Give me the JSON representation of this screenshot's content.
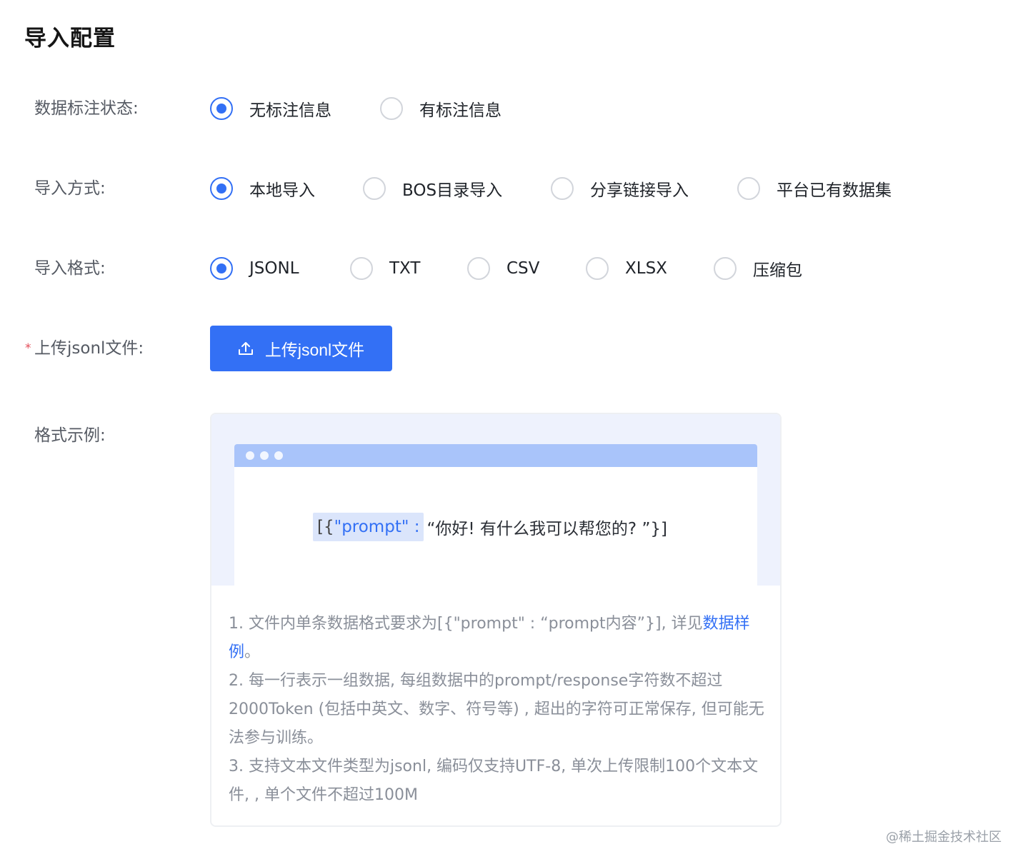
{
  "page": {
    "title": "导入配置"
  },
  "annotation_status": {
    "label": "数据标注状态:",
    "options": [
      {
        "label": "无标注信息",
        "checked": true
      },
      {
        "label": "有标注信息",
        "checked": false
      }
    ]
  },
  "import_method": {
    "label": "导入方式:",
    "options": [
      {
        "label": "本地导入",
        "checked": true
      },
      {
        "label": "BOS目录导入",
        "checked": false
      },
      {
        "label": "分享链接导入",
        "checked": false
      },
      {
        "label": "平台已有数据集",
        "checked": false
      }
    ]
  },
  "import_format": {
    "label": "导入格式:",
    "options": [
      {
        "label": "JSONL",
        "checked": true
      },
      {
        "label": "TXT",
        "checked": false
      },
      {
        "label": "CSV",
        "checked": false
      },
      {
        "label": "XLSX",
        "checked": false
      },
      {
        "label": "压缩包",
        "checked": false
      }
    ]
  },
  "upload": {
    "required_mark": "*",
    "label": "上传jsonl文件:",
    "button_label": "上传jsonl文件",
    "icon": "upload-icon"
  },
  "example": {
    "label": "格式示例:",
    "sample_bracket": "[{",
    "sample_key": "\"prompt\" :",
    "sample_value": "“你好! 有什么我可以帮您的? ”}]",
    "notes": {
      "line1_text": "1. 文件内单条数据格式要求为[{\"prompt\" : “prompt内容”}], 详见",
      "line1_link": "数据样例",
      "line1_end": "。",
      "line2": "2. 每一行表示一组数据, 每组数据中的prompt/response字符数不超过2000Token (包括中英文、数字、符号等) , 超出的字符可正常保存, 但可能无法参与训练。",
      "line3": "3. 支持文本文件类型为jsonl, 编码仅支持UTF-8, 单次上传限制100个文本文件, , 单个文件不超过100M"
    }
  },
  "colors": {
    "primary": "#3370f5",
    "preview_bg": "#eef2fd",
    "titlebar": "#a9c4fa"
  },
  "watermark": "@稀土掘金技术社区"
}
